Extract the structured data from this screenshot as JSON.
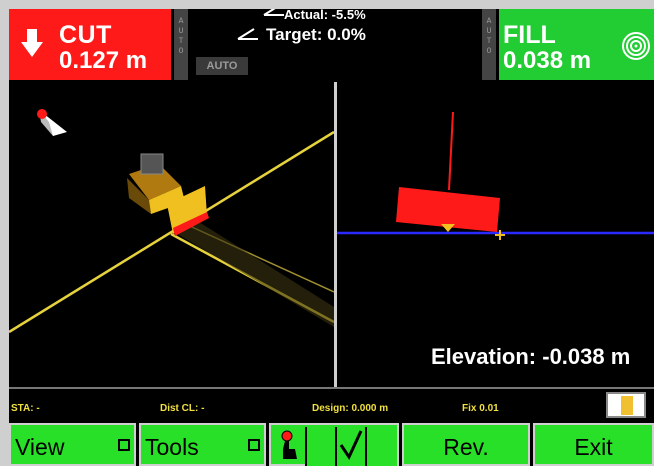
{
  "top": {
    "cut": {
      "label": "CUT",
      "value": "0.127 m",
      "color": "#ff1a1a"
    },
    "fill": {
      "label": "FILL",
      "value": "0.038 m",
      "color": "#22cc33"
    },
    "auto_strip_text": [
      "A",
      "U",
      "T",
      "O"
    ],
    "grade": {
      "actual": "Actual: -5.5%",
      "target": "Target: 0.0%"
    },
    "auto_button": "AUTO"
  },
  "view2d": {
    "elevation": "Elevation: -0.038 m"
  },
  "status": {
    "sta": "STA: -",
    "dist_cl": "Dist CL: -",
    "design": "Design: 0.000 m",
    "fix": "Fix 0.01"
  },
  "buttons": {
    "view": "View",
    "tools": "Tools",
    "rev": "Rev.",
    "exit": "Exit"
  },
  "icons": {
    "cut_arrow": "down-arrow-icon",
    "fill_target": "target-icon",
    "compass": "compass-icon",
    "joystick": "joystick-icon",
    "check": "check-icon"
  },
  "colors": {
    "machine": "#f0c020",
    "guide_lines": "#e6d23c",
    "blade": "#ff1a1a",
    "grade_line": "#2a2aff",
    "accent_green": "#28e028"
  }
}
